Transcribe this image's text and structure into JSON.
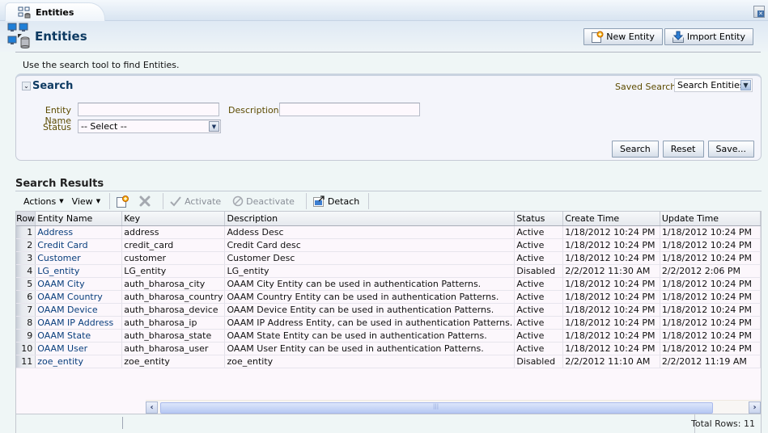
{
  "tab": {
    "label": "Entities",
    "icon": "entities-icon"
  },
  "header": {
    "title": "Entities",
    "buttons": {
      "new_entity": "New Entity",
      "import_entity": "Import Entity"
    },
    "intro": "Use the search tool to find Entities."
  },
  "search": {
    "title": "Search",
    "saved_search_label": "Saved Search",
    "saved_search_value": "Search Entities",
    "fields": {
      "entity_name_label": "Entity Name",
      "entity_name_value": "",
      "description_label": "Description",
      "description_value": "",
      "status_label": "Status",
      "status_value": "-- Select --"
    },
    "buttons": {
      "search": "Search",
      "reset": "Reset",
      "save": "Save..."
    }
  },
  "results": {
    "title": "Search Results",
    "toolbar": {
      "actions": "Actions",
      "view": "View",
      "activate": "Activate",
      "deactivate": "Deactivate",
      "detach": "Detach"
    },
    "columns": [
      "Row",
      "Entity Name",
      "Key",
      "Description",
      "Status",
      "Create Time",
      "Update Time"
    ],
    "rows": [
      {
        "row": "1",
        "name": "Address",
        "key": "address",
        "desc": "Addess Desc",
        "status": "Active",
        "created": "1/18/2012 10:24 PM",
        "updated": "1/18/2012 10:24 PM"
      },
      {
        "row": "2",
        "name": "Credit Card",
        "key": "credit_card",
        "desc": "Credit Card desc",
        "status": "Active",
        "created": "1/18/2012 10:24 PM",
        "updated": "1/18/2012 10:24 PM"
      },
      {
        "row": "3",
        "name": "Customer",
        "key": "customer",
        "desc": "Customer Desc",
        "status": "Active",
        "created": "1/18/2012 10:24 PM",
        "updated": "1/18/2012 10:24 PM"
      },
      {
        "row": "4",
        "name": "LG_entity",
        "key": "LG_entity",
        "desc": "LG_entity",
        "status": "Disabled",
        "created": "2/2/2012 11:30 AM",
        "updated": "2/2/2012 2:06 PM"
      },
      {
        "row": "5",
        "name": "OAAM City",
        "key": "auth_bharosa_city",
        "desc": "OAAM City Entity can be used in authentication Patterns.",
        "status": "Active",
        "created": "1/18/2012 10:24 PM",
        "updated": "1/18/2012 10:24 PM"
      },
      {
        "row": "6",
        "name": "OAAM Country",
        "key": "auth_bharosa_country",
        "desc": "OAAM Country Entity can be used in authentication Patterns.",
        "status": "Active",
        "created": "1/18/2012 10:24 PM",
        "updated": "1/18/2012 10:24 PM"
      },
      {
        "row": "7",
        "name": "OAAM Device",
        "key": "auth_bharosa_device",
        "desc": "OAAM Device Entity can be used in authentication Patterns.",
        "status": "Active",
        "created": "1/18/2012 10:24 PM",
        "updated": "1/18/2012 10:24 PM"
      },
      {
        "row": "8",
        "name": "OAAM IP Address",
        "key": "auth_bharosa_ip",
        "desc": "OAAM IP Address Entity, can be used in authentication Patterns.",
        "status": "Active",
        "created": "1/18/2012 10:24 PM",
        "updated": "1/18/2012 10:24 PM"
      },
      {
        "row": "9",
        "name": "OAAM State",
        "key": "auth_bharosa_state",
        "desc": "OAAM State Entity can be used in authentication Patterns.",
        "status": "Active",
        "created": "1/18/2012 10:24 PM",
        "updated": "1/18/2012 10:24 PM"
      },
      {
        "row": "10",
        "name": "OAAM User",
        "key": "auth_bharosa_user",
        "desc": "OAAM User Entity can be used in authentication Patterns.",
        "status": "Active",
        "created": "1/18/2012 10:24 PM",
        "updated": "1/18/2012 10:24 PM"
      },
      {
        "row": "11",
        "name": "zoe_entity",
        "key": "zoe_entity",
        "desc": "zoe_entity",
        "status": "Disabled",
        "created": "2/2/2012 11:10 AM",
        "updated": "2/2/2012 11:19 AM"
      }
    ],
    "total_rows": "Total Rows: 11"
  },
  "colors": {
    "title": "#0d3a62",
    "label": "#5c4b00",
    "link": "#083e7c",
    "key_column_marker": "#2a92c9"
  }
}
